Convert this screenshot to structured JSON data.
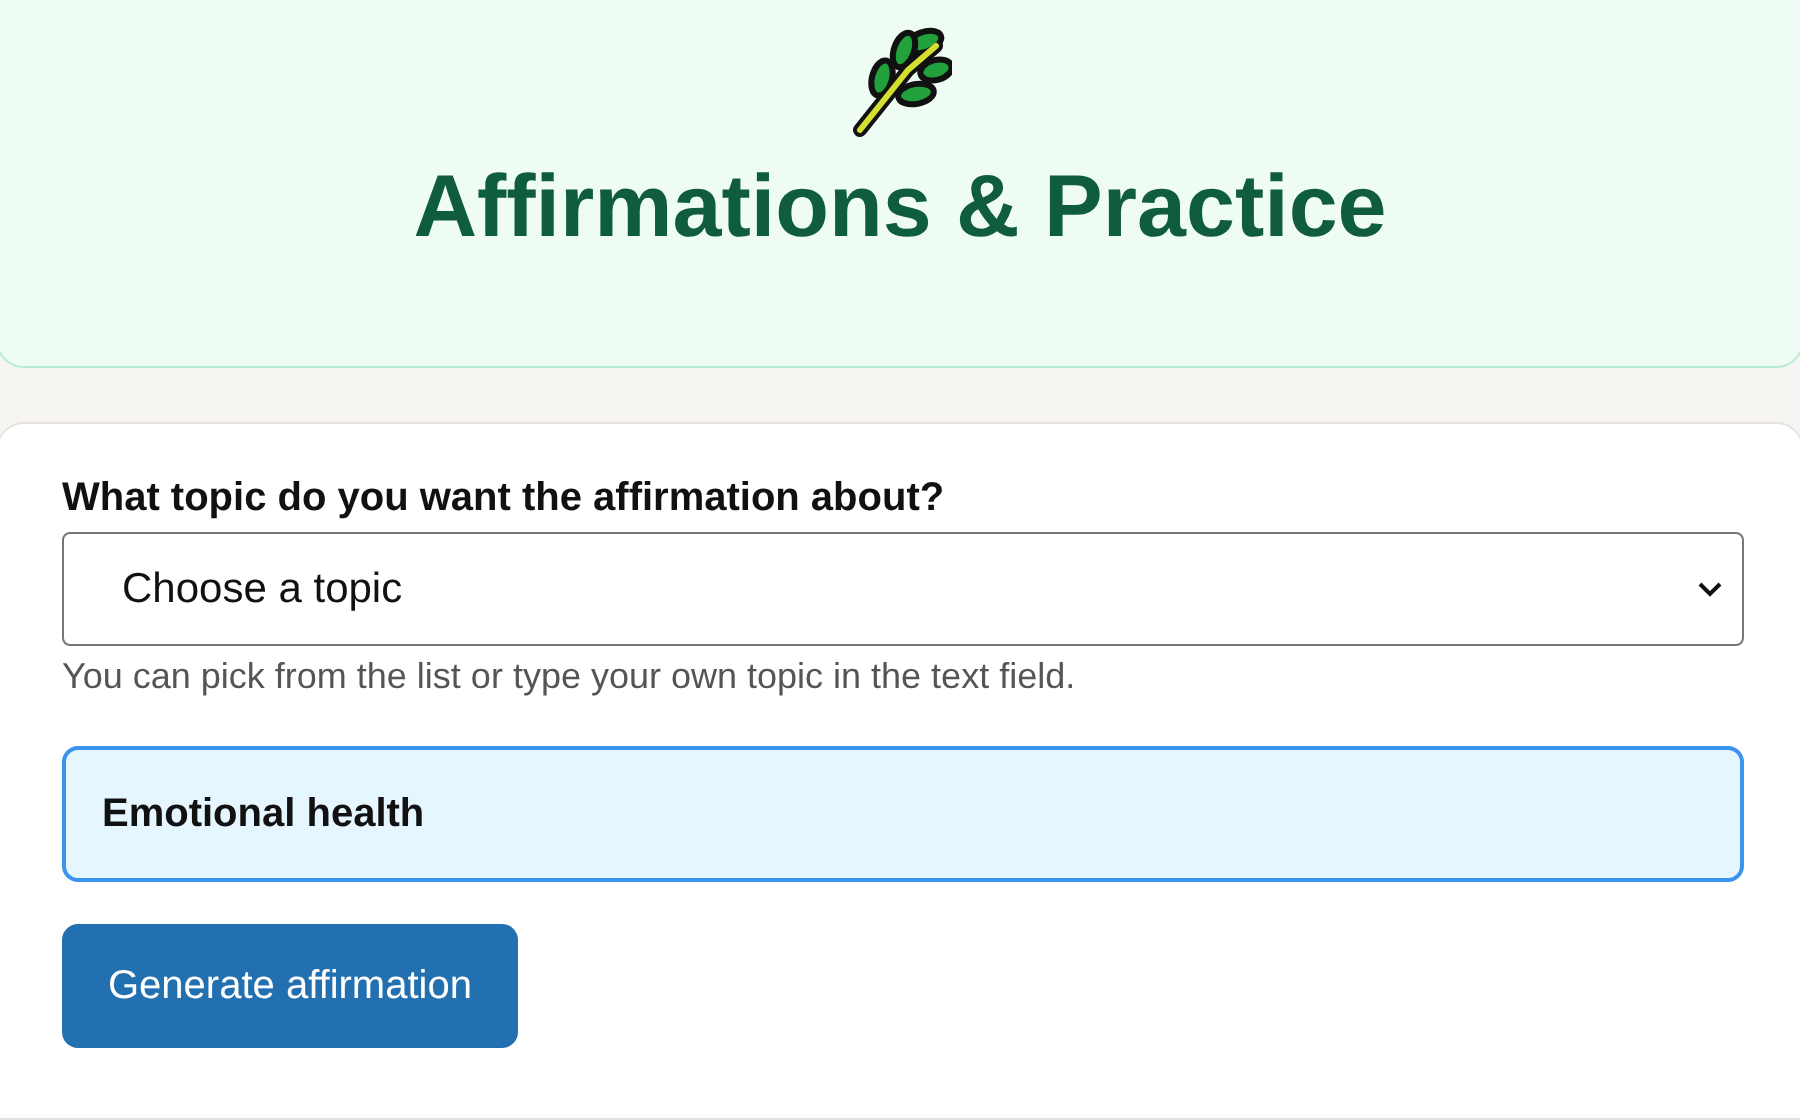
{
  "header": {
    "title": "Affirmations & Practice"
  },
  "form": {
    "label": "What topic do you want the affirmation about?",
    "select": {
      "value": "Choose a topic"
    },
    "hint": "You can pick from the list or type your own topic in the text field.",
    "topic_field": {
      "value": "Emotional health",
      "focused": true
    },
    "button": "Generate affirmation"
  }
}
